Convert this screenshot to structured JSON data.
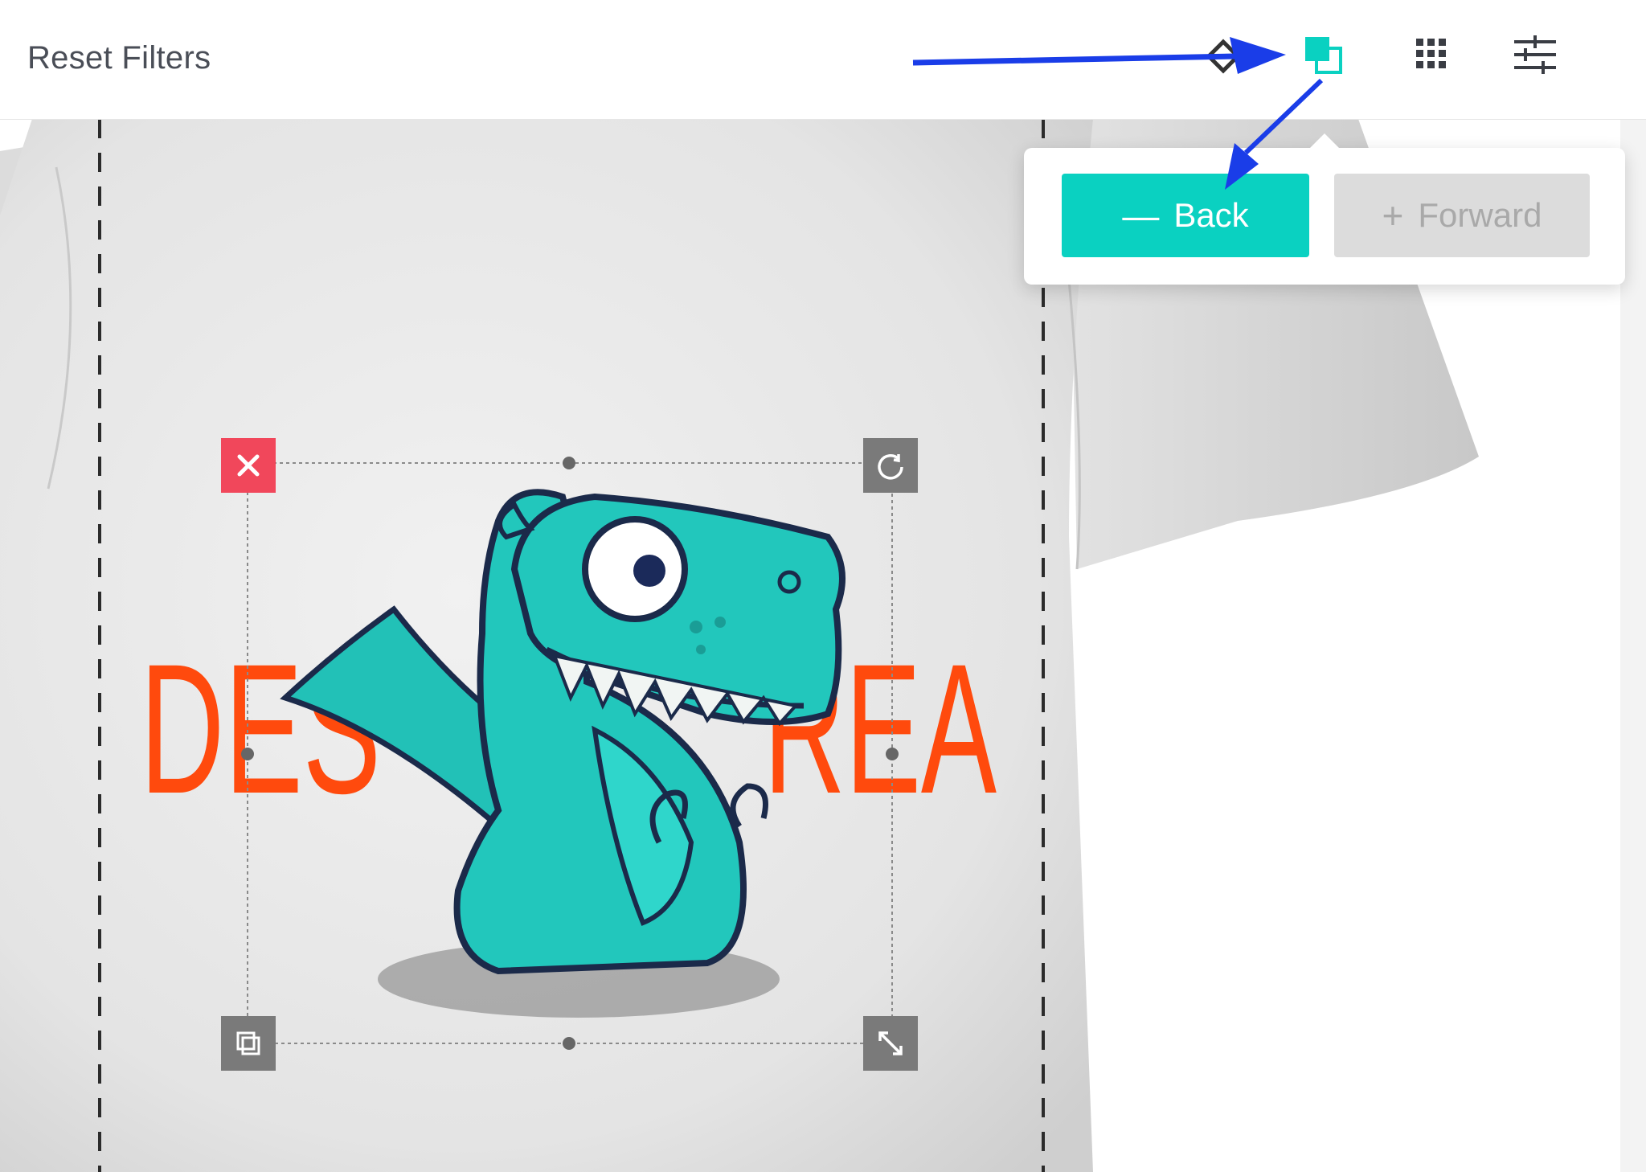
{
  "toolbar": {
    "reset_filters_label": "Reset Filters",
    "icons": [
      "flip-icon",
      "layers-icon",
      "grid-icon",
      "sliders-icon"
    ]
  },
  "popover": {
    "back_label": "Back",
    "back_sign": "—",
    "forward_label": "Forward",
    "forward_sign": "+"
  },
  "canvas": {
    "printed_text": "DESIGN AREA",
    "printed_text_visible_left": "DES",
    "printed_text_visible_right": "REA",
    "graphic": "teal-dinosaur-illustration"
  },
  "colors": {
    "accent": "#0ad1c1",
    "disabled": "#dcdcdc",
    "delete": "#f1475b",
    "handle": "#7a7a7a",
    "design_text": "#ff4a0d",
    "annotation_arrow": "#1a3de8"
  }
}
